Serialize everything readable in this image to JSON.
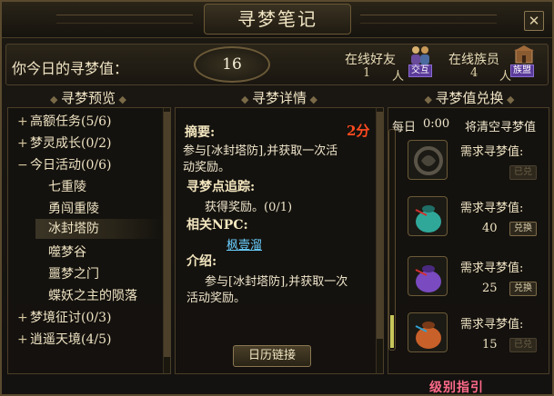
{
  "window": {
    "title": "寻梦笔记",
    "close_glyph": "✕"
  },
  "value_bar": {
    "label": "你今日的寻梦值：",
    "value": "16",
    "friends": {
      "label": "在线好友",
      "count": "1",
      "unit": "人",
      "icon_caption": "交互"
    },
    "clan": {
      "label": "在线族员",
      "count": "4",
      "unit": "人",
      "icon_caption": "族盟"
    }
  },
  "headers": {
    "preview": "寻梦预览",
    "detail": "寻梦详情",
    "exchange": "寻梦值兑换"
  },
  "tree": {
    "items": [
      {
        "toggle": "+",
        "label": "高额任务(5/6)"
      },
      {
        "toggle": "+",
        "label": "梦灵成长(0/2)"
      },
      {
        "toggle": "−",
        "label": "今日活动(0/6)"
      },
      {
        "toggle": "",
        "label": "七重陵"
      },
      {
        "toggle": "",
        "label": "勇闯重陵"
      },
      {
        "toggle": "",
        "label": "冰封塔防"
      },
      {
        "toggle": "",
        "label": "噬梦谷"
      },
      {
        "toggle": "",
        "label": "噩梦之门"
      },
      {
        "toggle": "",
        "label": "蝶妖之主的陨落"
      },
      {
        "toggle": "+",
        "label": "梦境征讨(0/3)"
      },
      {
        "toggle": "+",
        "label": "逍遥天境(4/5)"
      }
    ]
  },
  "detail": {
    "summary_head": "摘要:",
    "points": "2分",
    "summary_text_1": "参与[冰封塔防],并获取一次活",
    "summary_text_2": "动奖励。",
    "track_head": "寻梦点追踪:",
    "track_text": "获得奖励。(0/1)",
    "npc_head": "相关NPC:",
    "npc_link": "枫壹溜",
    "intro_head": "介绍:",
    "intro_text_1": "参与[冰封塔防],并获取一次",
    "intro_text_2": "活动奖励。",
    "calendar_button": "日历链接"
  },
  "exchange": {
    "daily_label": "每日",
    "daily_time": "0:00",
    "daily_action": "将清空寻梦值",
    "rows": [
      {
        "req": "需求寻梦值:",
        "value": "",
        "button": "已兑",
        "state": "disabled"
      },
      {
        "req": "需求寻梦值:",
        "value": "40",
        "button": "兑换",
        "state": "active"
      },
      {
        "req": "需求寻梦值:",
        "value": "25",
        "button": "兑换",
        "state": "active"
      },
      {
        "req": "需求寻梦值:",
        "value": "15",
        "button": "已兑",
        "state": "disabled"
      }
    ],
    "progress_fraction": 0.15
  },
  "footer": {
    "guide_link": "级别指引"
  },
  "colors": {
    "accent_gold": "#6b5a38",
    "points_red": "#ff4a20",
    "link_blue": "#6ad0ff",
    "guide_pink": "#ff6a8a"
  }
}
